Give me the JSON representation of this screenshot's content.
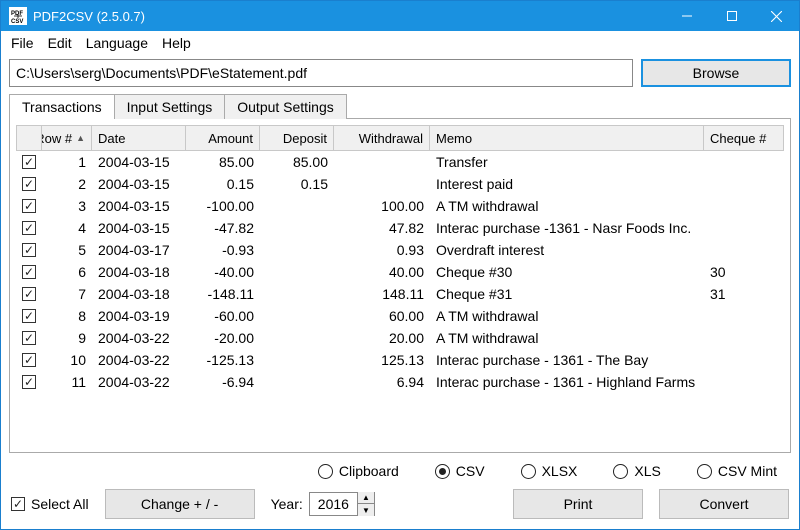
{
  "window": {
    "title": "PDF2CSV (2.5.0.7)"
  },
  "menu": {
    "file": "File",
    "edit": "Edit",
    "language": "Language",
    "help": "Help"
  },
  "file": {
    "path": "C:\\Users\\serg\\Documents\\PDF\\eStatement.pdf",
    "browse": "Browse"
  },
  "tabs": {
    "transactions": "Transactions",
    "input": "Input Settings",
    "output": "Output Settings"
  },
  "columns": {
    "row": "Row #",
    "date": "Date",
    "amount": "Amount",
    "deposit": "Deposit",
    "withdrawal": "Withdrawal",
    "memo": "Memo",
    "cheque": "Cheque #"
  },
  "rows": [
    {
      "n": "1",
      "date": "2004-03-15",
      "amount": "85.00",
      "deposit": "85.00",
      "withdrawal": "",
      "memo": "Transfer",
      "cheque": ""
    },
    {
      "n": "2",
      "date": "2004-03-15",
      "amount": "0.15",
      "deposit": "0.15",
      "withdrawal": "",
      "memo": "Interest paid",
      "cheque": ""
    },
    {
      "n": "3",
      "date": "2004-03-15",
      "amount": "-100.00",
      "deposit": "",
      "withdrawal": "100.00",
      "memo": "A TM withdrawal",
      "cheque": ""
    },
    {
      "n": "4",
      "date": "2004-03-15",
      "amount": "-47.82",
      "deposit": "",
      "withdrawal": "47.82",
      "memo": "Interac purchase -1361 - Nasr Foods Inc.",
      "cheque": ""
    },
    {
      "n": "5",
      "date": "2004-03-17",
      "amount": "-0.93",
      "deposit": "",
      "withdrawal": "0.93",
      "memo": "Overdraft interest",
      "cheque": ""
    },
    {
      "n": "6",
      "date": "2004-03-18",
      "amount": "-40.00",
      "deposit": "",
      "withdrawal": "40.00",
      "memo": "Cheque #30",
      "cheque": "30"
    },
    {
      "n": "7",
      "date": "2004-03-18",
      "amount": "-148.11",
      "deposit": "",
      "withdrawal": "148.11",
      "memo": "Cheque #31",
      "cheque": "31"
    },
    {
      "n": "8",
      "date": "2004-03-19",
      "amount": "-60.00",
      "deposit": "",
      "withdrawal": "60.00",
      "memo": "A TM withdrawal",
      "cheque": ""
    },
    {
      "n": "9",
      "date": "2004-03-22",
      "amount": "-20.00",
      "deposit": "",
      "withdrawal": "20.00",
      "memo": "A TM withdrawal",
      "cheque": ""
    },
    {
      "n": "10",
      "date": "2004-03-22",
      "amount": "-125.13",
      "deposit": "",
      "withdrawal": "125.13",
      "memo": "Interac purchase - 1361 - The Bay",
      "cheque": ""
    },
    {
      "n": "11",
      "date": "2004-03-22",
      "amount": "-6.94",
      "deposit": "",
      "withdrawal": "6.94",
      "memo": "Interac purchase - 1361 - Highland Farms",
      "cheque": ""
    }
  ],
  "radios": {
    "clipboard": "Clipboard",
    "csv": "CSV",
    "xlsx": "XLSX",
    "xls": "XLS",
    "csvmint": "CSV Mint"
  },
  "bottom": {
    "selectall": "Select All",
    "change": "Change + / -",
    "yearlabel": "Year:",
    "year": "2016",
    "print": "Print",
    "convert": "Convert"
  }
}
